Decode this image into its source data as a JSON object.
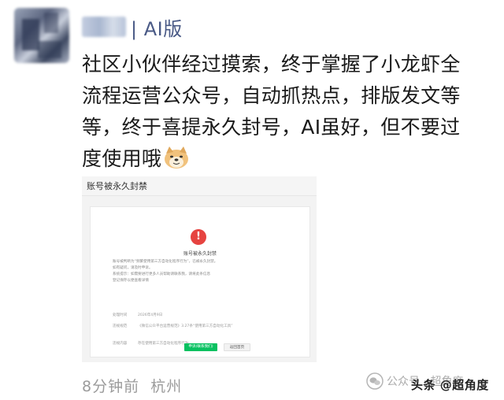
{
  "post": {
    "author_tag": "| AI版",
    "text": "社区小伙伴经过摸索，终于掌握了小龙虾全流程运营公众号，自动抓热点，排版发文等等，终于喜提永久封号，AI虽好，但不要过度使用哦",
    "emoji": "doge-emoji",
    "time": "8分钟前",
    "location": "杭州"
  },
  "screenshot": {
    "header_title": "账号被永久封禁",
    "card_title": "账号被永久封禁",
    "body_lines": [
      "账号被判断为“频繁使用第三方自动化程序行为”，已被永久封禁。",
      "如有疑问，请及时申诉。",
      "系统提示：如需要进行更多人员帮助请联系我，请将此条信息",
      "登记保存以便查看详情"
    ],
    "fields": [
      {
        "label": "处理时间",
        "value": "2026年4月9日"
      },
      {
        "label": "违规规范",
        "value": "《微信公众平台运营规范》3.27条“使用第三方自动化工具”"
      },
      {
        "label": "违规内容",
        "value": "存在使用第三方自动化程序行为"
      }
    ],
    "primary_button": "申诉(联系我们)",
    "secondary_button": "返回首页"
  },
  "watermark": {
    "platform_icon": "wechat-icon",
    "platform_text": "公众号 · 超角度",
    "source_text": "头条 @超角度"
  },
  "colors": {
    "name_tag": "#4a5a86",
    "warning": "#e64340",
    "primary_button": "#07c160",
    "meta_text": "#9b9b9b"
  }
}
